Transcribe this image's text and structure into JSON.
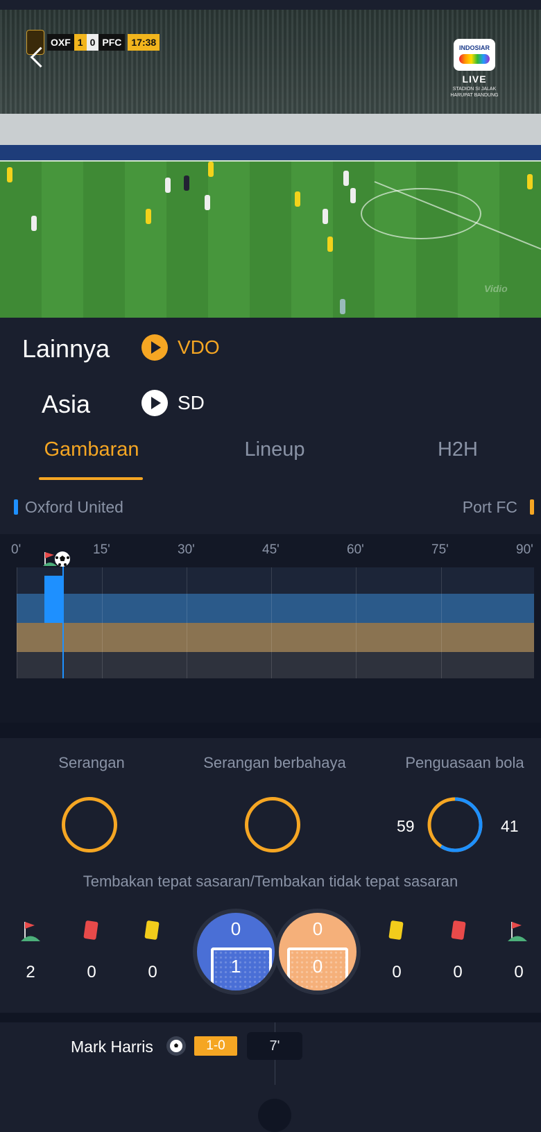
{
  "video": {
    "scorebug": {
      "home": "OXF",
      "home_score": "1",
      "away_score": "0",
      "away": "PFC",
      "clock": "17:38"
    },
    "channel_logo": "INDOSIAR",
    "live_label": "LIVE",
    "venue": "STADION SI JALAK HARUPAT BANDUNG",
    "watermark": "Vidio"
  },
  "sources": [
    {
      "label": "Lainnya",
      "option": "VDO",
      "color": "#f5a623"
    },
    {
      "label": "Asia",
      "option": "SD",
      "color": "#ffffff"
    }
  ],
  "tabs": [
    {
      "label": "Gambaran",
      "active": true
    },
    {
      "label": "Lineup",
      "active": false
    },
    {
      "label": "H2H",
      "active": false
    }
  ],
  "teams": {
    "home": "Oxford United",
    "away": "Port FC",
    "home_color": "#1e90ff",
    "away_color": "#f5a623"
  },
  "timeline": {
    "ticks": [
      "0'",
      "15'",
      "30'",
      "45'",
      "60'",
      "75'",
      "90'"
    ],
    "current_minute": 8
  },
  "stats": {
    "attacks_label": "Serangan",
    "dangerous_label": "Serangan berbahaya",
    "possession_label": "Penguasaan bola",
    "possession_home": "59",
    "possession_away": "41",
    "shots_label": "Tembakan tepat sasaran/Tembakan tidak tepat sasaran",
    "home": {
      "corners": "2",
      "red": "0",
      "yellow": "0",
      "on_target": "0",
      "off_target": "1"
    },
    "away": {
      "on_target": "0",
      "off_target": "0",
      "yellow": "0",
      "red": "0",
      "corners": "0"
    }
  },
  "events": [
    {
      "player": "Mark Harris",
      "score": "1-0",
      "minute": "7'"
    }
  ]
}
